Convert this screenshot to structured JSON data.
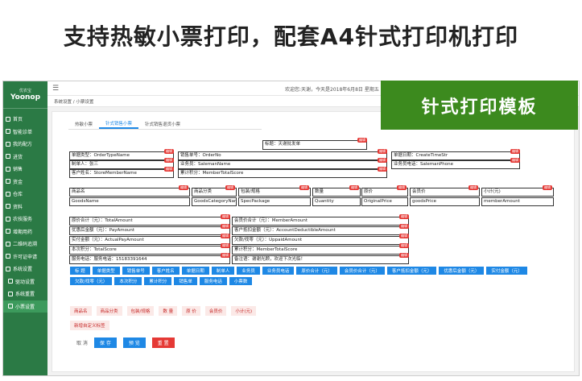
{
  "banner": {
    "title": "支持热敏小票打印，配套A4针式打印机打印"
  },
  "overlay": {
    "title": "针式打印模板"
  },
  "app": {
    "logo": "Yoonop",
    "logo_cn": "优农宝",
    "welcome": "欢迎您:天谢，今天是2018年6月8日 星期五"
  },
  "sidebar": {
    "items": [
      {
        "label": "首页"
      },
      {
        "label": "智能诊单"
      },
      {
        "label": "我的配方"
      },
      {
        "label": "进货"
      },
      {
        "label": "销售"
      },
      {
        "label": "资金"
      },
      {
        "label": "仓库"
      },
      {
        "label": "资料"
      },
      {
        "label": "农技服务"
      },
      {
        "label": "增期用药"
      },
      {
        "label": "二维码追溯"
      },
      {
        "label": "许可证申请"
      },
      {
        "label": "系统设置"
      },
      {
        "label": "驱动设置"
      },
      {
        "label": "系统重置"
      },
      {
        "label": "小票设置"
      }
    ]
  },
  "breadcrumb": "系统设置 / 小票设置",
  "tabs": [
    {
      "label": "热敏小票"
    },
    {
      "label": "针式销售小票"
    },
    {
      "label": "针式销售退货小票"
    }
  ],
  "template": {
    "title": "标题：天谢批发单",
    "row1": [
      "单据类型：OrderTypeName",
      "销售单号：OrderNo",
      "单据日期：CreateTimeStr"
    ],
    "row2": [
      "制单人：张三",
      "业务员：SalemanName",
      "业务员电话：SalemanPhone"
    ],
    "row3": [
      "客户姓名：StoreMemberName",
      "累计积分：MemberTotalScore"
    ],
    "headers": [
      "商品名",
      "商品分类",
      "包装/规格",
      "数量",
      "原价",
      "会员价",
      "小计(元)"
    ],
    "fields": [
      "GoodsName",
      "GoodsCategoryName",
      "SpecPackage",
      "Quantity",
      "OriginalPrice",
      "goodsPrice",
      "memberAmount"
    ],
    "footer_left": [
      "原价合计（元）：TotalAmount",
      "优惠后金额（元）：PayAmount",
      "实付金额（元）：ActualPayAmount",
      "本次积分：TotalScore",
      "服务电话：服务电话：15183391644"
    ],
    "footer_right": [
      "会员价合计（元）：MemberAmount",
      "客户抵扣金额（元）：AccountDeductibleAmount",
      "欠款/找零（元）：UppaidAmount",
      "累计积分：MemberTotalScore",
      "备注语：谢谢光顾，欢迎下次光临！"
    ],
    "edit_label": "编辑"
  },
  "field_buttons": [
    "标 题",
    "单据类型",
    "销售单号",
    "客户姓名",
    "单据日期",
    "制单人",
    "业务员",
    "业务员电话",
    "原价合计（元）",
    "会员价合计（元）",
    "客户抵扣金额（元）",
    "优惠后金额（元）",
    "实付金额（元）",
    "欠款/找零（元）",
    "本次积分",
    "累计积分",
    "销售单",
    "服务电话",
    "小票数"
  ],
  "column_chips": [
    "商品名",
    "商品分类",
    "包装/规格",
    "数 量",
    "原 价",
    "会员价",
    "小计(元)"
  ],
  "custom_button": "新增自定义标签",
  "actions": {
    "cancel": "取 消",
    "save": "保 存",
    "preview": "预 览",
    "reset": "重 置"
  }
}
